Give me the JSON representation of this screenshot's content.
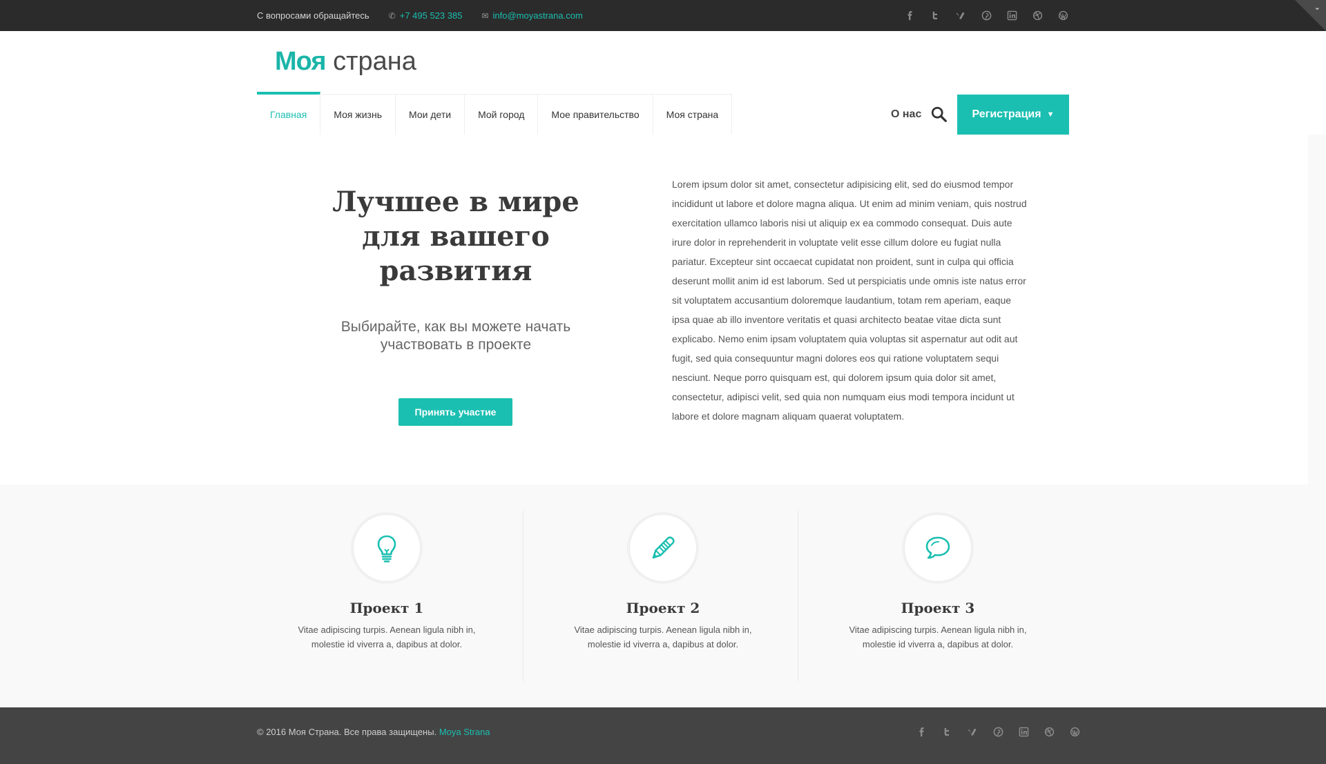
{
  "topbar": {
    "contact_text": "С вопросами обращайтесь",
    "phone": "+7 495 523 385",
    "email": "info@moyastrana.com",
    "social_icons": [
      "facebook-icon",
      "twitter-icon",
      "vimeo-icon",
      "pinterest-icon",
      "linkedin-icon",
      "dribbble-icon",
      "wordpress-icon"
    ],
    "corner_arrow": "⌄"
  },
  "header": {
    "logo_bold": "Моя",
    "logo_light": " страна",
    "nav": [
      "Главная",
      "Моя жизнь",
      "Мои дети",
      "Мой город",
      "Мое правительство",
      "Моя страна"
    ],
    "about": "О нас",
    "register": "Регистрация",
    "register_caret": "▼"
  },
  "hero": {
    "title_lines": [
      "Лучшее в мире",
      "для вашего",
      "развития"
    ],
    "subtitle_lines": [
      "Выбирайте, как вы можете начать",
      "участвовать в проекте"
    ],
    "cta": "Принять участие",
    "text": "Lorem ipsum dolor sit amet, consectetur adipisicing elit, sed do eiusmod tempor incididunt ut labore et dolore magna aliqua. Ut enim ad minim veniam, quis nostrud exercitation ullamco laboris nisi ut aliquip ex ea commodo consequat. Duis aute irure dolor in reprehenderit in voluptate velit esse cillum dolore eu fugiat nulla pariatur. Excepteur sint occaecat cupidatat non proident, sunt in culpa qui officia deserunt mollit anim id est laborum. Sed ut perspiciatis unde omnis iste natus error sit voluptatem accusantium doloremque laudantium, totam rem aperiam, eaque ipsa quae ab illo inventore veritatis et quasi architecto beatae vitae dicta sunt explicabo. Nemo enim ipsam voluptatem quia voluptas sit aspernatur aut odit aut fugit, sed quia consequuntur magni dolores eos qui ratione voluptatem sequi nesciunt. Neque porro quisquam est, qui dolorem ipsum quia dolor sit amet, consectetur, adipisci velit, sed quia non numquam eius modi tempora incidunt ut labore et dolore magnam aliquam quaerat voluptatem."
  },
  "features": [
    {
      "icon": "lightbulb-icon",
      "title": "Проект 1",
      "desc_lines": [
        "Vitae adipiscing turpis. Aenean ligula nibh in,",
        "molestie id viverra a, dapibus at dolor."
      ]
    },
    {
      "icon": "pencil-icon",
      "title": "Проект 2",
      "desc_lines": [
        "Vitae adipiscing turpis. Aenean ligula nibh in,",
        "molestie id viverra a, dapibus at dolor."
      ]
    },
    {
      "icon": "speech-bubble-icon",
      "title": "Проект 3",
      "desc_lines": [
        "Vitae adipiscing turpis. Aenean ligula nibh in,",
        "molestie id viverra a, dapibus at dolor."
      ]
    }
  ],
  "footer": {
    "copyright": "© 2016 Моя Страна. Все права защищены.",
    "link": "Moya Strana"
  },
  "colors": {
    "accent": "#1bbfb1",
    "topbar": "#2b2b2b",
    "footer": "#444444"
  }
}
